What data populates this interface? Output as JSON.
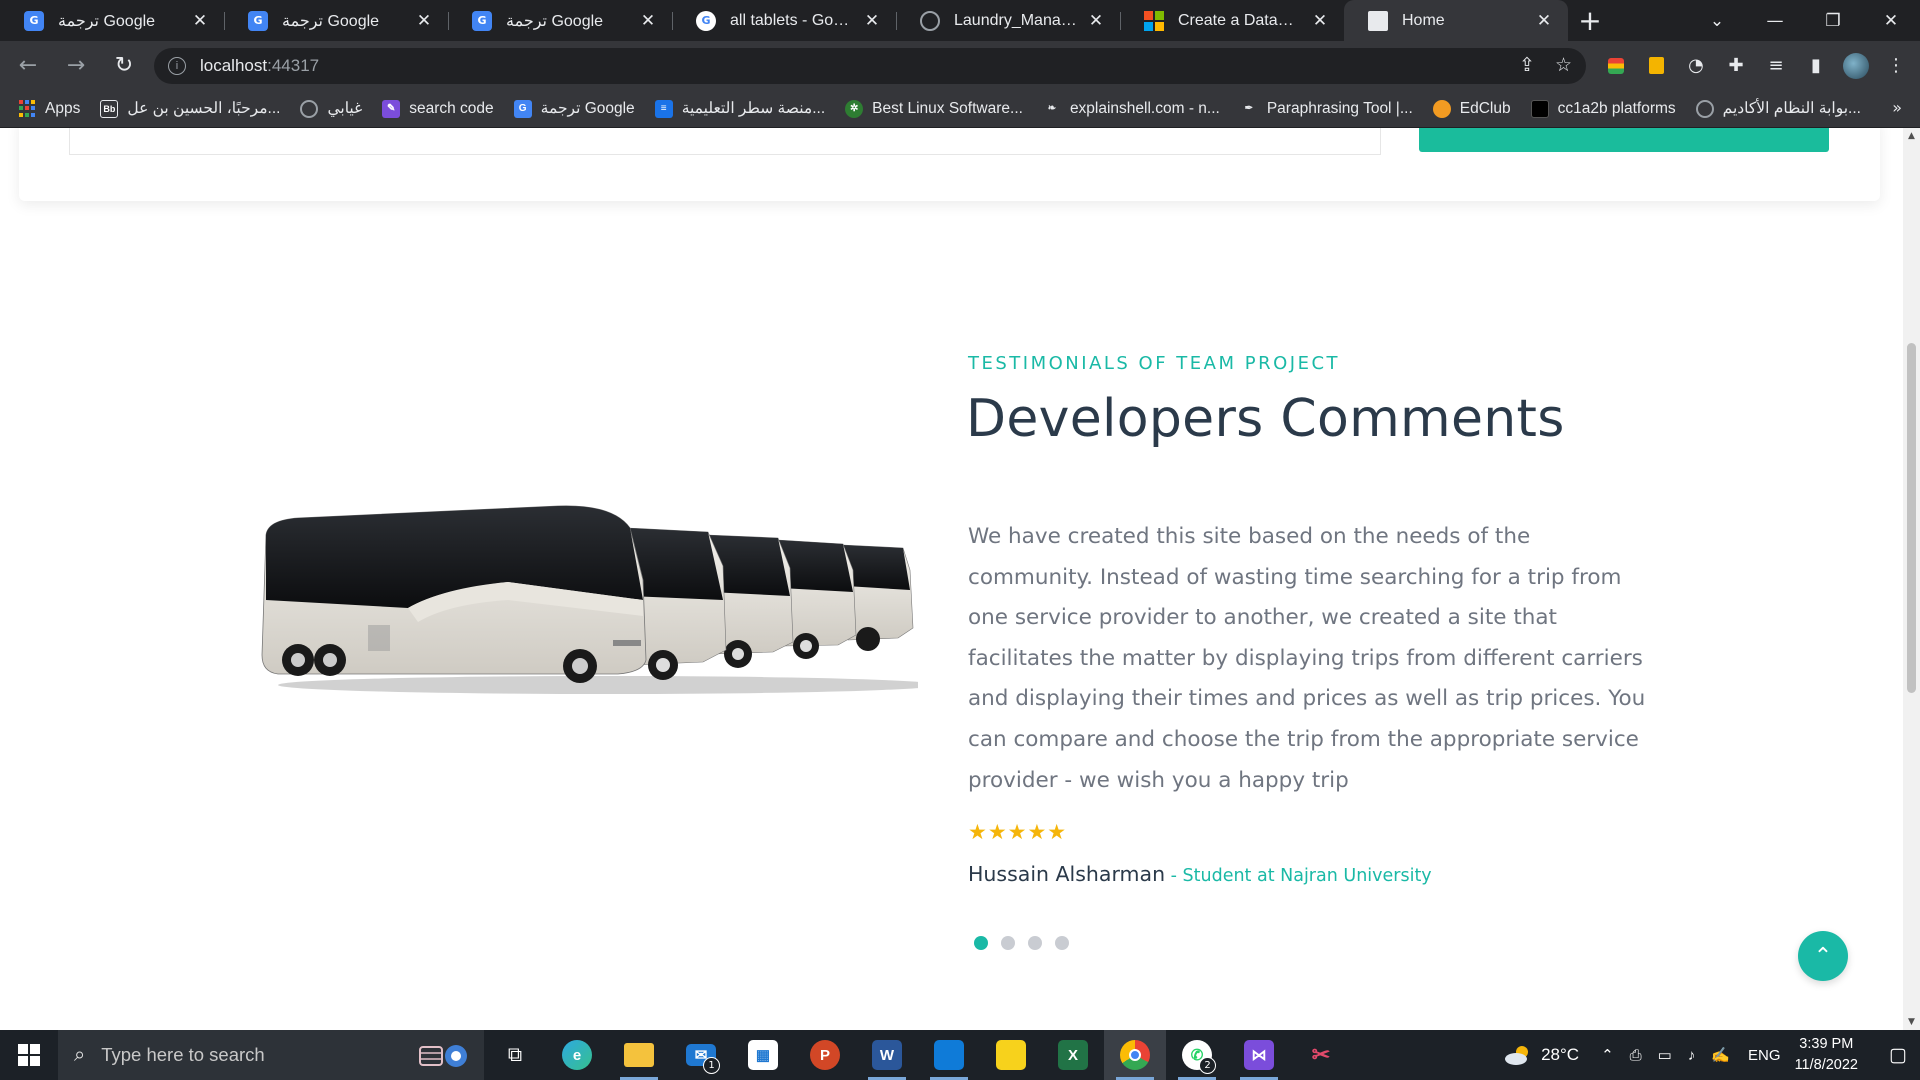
{
  "browser": {
    "tabs": [
      {
        "title": "ترجمة Google",
        "favicon": "google-translate-icon",
        "color": "#4285f4"
      },
      {
        "title": "ترجمة Google",
        "favicon": "google-translate-icon",
        "color": "#4285f4"
      },
      {
        "title": "ترجمة Google",
        "favicon": "google-translate-icon",
        "color": "#4285f4"
      },
      {
        "title": "all tablets - Google Se",
        "favicon": "google-icon",
        "color": "#ffffff"
      },
      {
        "title": "Laundry_Managemen",
        "favicon": "globe-icon",
        "color": "#9aa0a6"
      },
      {
        "title": "Create a Database - S",
        "favicon": "microsoft-icon",
        "color": "#f25022"
      },
      {
        "title": "Home",
        "favicon": "page-icon",
        "color": "#e8eaed",
        "active": true
      }
    ],
    "new_tab_glyph": "+",
    "window_controls": {
      "minimize": "—",
      "restore": "❐",
      "close": "✕",
      "tab_search": "⌄"
    },
    "url": {
      "host": "localhost",
      "port": ":44317"
    },
    "bookmarks": [
      {
        "label": "Apps",
        "icon": "apps-grid-icon"
      },
      {
        "label": "مرحبًا، الحسين بن عل...",
        "icon": "blackboard-icon"
      },
      {
        "label": "غيابي",
        "icon": "globe-icon"
      },
      {
        "label": "search code",
        "icon": "search-code-icon"
      },
      {
        "label": "ترجمة Google",
        "icon": "google-translate-icon"
      },
      {
        "label": "منصة سطر التعليمية...",
        "icon": "satr-icon"
      },
      {
        "label": "Best Linux Software...",
        "icon": "linux-gear-icon"
      },
      {
        "label": "explainshell.com - n...",
        "icon": "shell-icon"
      },
      {
        "label": "Paraphrasing Tool |...",
        "icon": "quill-icon"
      },
      {
        "label": "EdClub",
        "icon": "edclub-icon"
      },
      {
        "label": "cc1a2b platforms",
        "icon": "cc-icon"
      },
      {
        "label": "بوابة النظام الأكاديم...",
        "icon": "globe-icon"
      }
    ],
    "bookmarks_more": "»"
  },
  "page": {
    "eyebrow": "TESTIMONIALS OF TEAM PROJECT",
    "heading": "Developers Comments",
    "quote": "We have created this site based on the needs of the community. Instead of wasting time searching for a trip from one service provider to another, we created a site that facilitates the matter by displaying trips from different carriers and displaying their times and prices as well as trip prices. You can compare and choose the trip from the appropriate service provider - we wish you a happy trip",
    "rating": 5,
    "rating_stars": "★★★★★",
    "author_name": "Hussain Alsharman",
    "author_role": " - Student at Najran University",
    "slides": 4,
    "active_slide": 1,
    "accent_color": "#1ab9a6",
    "back_to_top_glyph": "⌃"
  },
  "taskbar": {
    "search_placeholder": "Type here to search",
    "apps": [
      "task-view",
      "edge",
      "file-explorer",
      "mail",
      "microsoft-store",
      "powerpoint",
      "word",
      "blue-app",
      "sticky-notes",
      "excel",
      "chrome",
      "whatsapp",
      "visual-studio",
      "snipping-tool"
    ],
    "mail_badge": "1",
    "whatsapp_badge": "2",
    "weather": "28°C",
    "language": "ENG",
    "time": "3:39 PM",
    "date": "11/8/2022"
  }
}
